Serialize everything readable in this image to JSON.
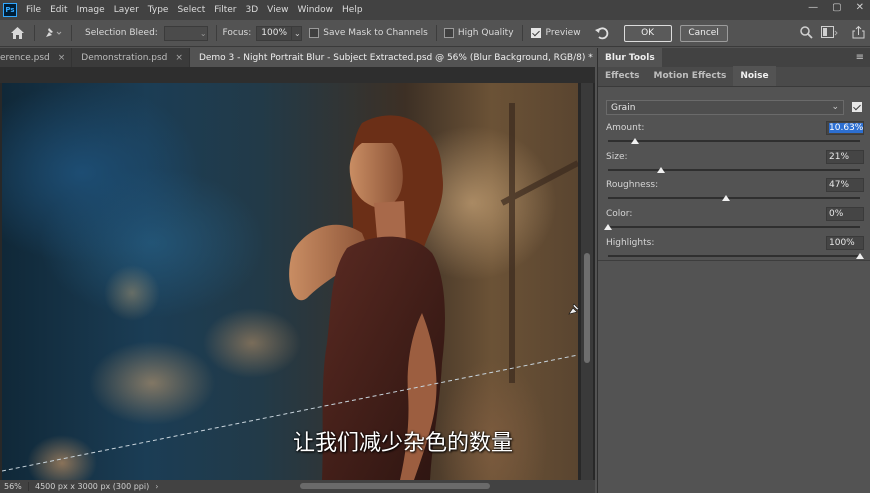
{
  "menubar": {
    "logo": "Ps",
    "items": [
      "File",
      "Edit",
      "Image",
      "Layer",
      "Type",
      "Select",
      "Filter",
      "3D",
      "View",
      "Window",
      "Help"
    ],
    "controls": [
      "—",
      "▢",
      "✕"
    ]
  },
  "options": {
    "selection_bleed_label": "Selection Bleed:",
    "selection_bleed_value": "",
    "focus_label": "Focus:",
    "focus_value": "100%",
    "save_mask_label": "Save Mask to Channels",
    "save_mask_checked": false,
    "high_quality_label": "High Quality",
    "high_quality_checked": false,
    "preview_label": "Preview",
    "preview_checked": true,
    "ok_label": "OK",
    "cancel_label": "Cancel"
  },
  "tabs": [
    {
      "label": "erence.psd",
      "active": false
    },
    {
      "label": "Demonstration.psd",
      "active": false
    },
    {
      "label": "Demo 3 - Night Portrait Blur - Subject Extracted.psd @ 56% (Blur Background, RGB/8) *",
      "active": true
    }
  ],
  "caption": "让我们减少杂色的数量",
  "status": {
    "zoom": "56%",
    "dimensions": "4500 px x 3000 px (300 ppi)",
    "arrow": "›"
  },
  "panel": {
    "title": "Blur Tools",
    "tabs": [
      {
        "label": "Effects",
        "active": false
      },
      {
        "label": "Motion Effects",
        "active": false
      },
      {
        "label": "Noise",
        "active": true
      }
    ],
    "grain_select": "Grain",
    "grain_enabled": true,
    "params": [
      {
        "label": "Amount:",
        "value": "10.63%",
        "level": 0.1063,
        "selected": true
      },
      {
        "label": "Size:",
        "value": "21%",
        "level": 0.21,
        "selected": false
      },
      {
        "label": "Roughness:",
        "value": "47%",
        "level": 0.47,
        "selected": false
      },
      {
        "label": "Color:",
        "value": "0%",
        "level": 0.0,
        "selected": false
      },
      {
        "label": "Highlights:",
        "value": "100%",
        "level": 1.0,
        "selected": false
      }
    ]
  }
}
